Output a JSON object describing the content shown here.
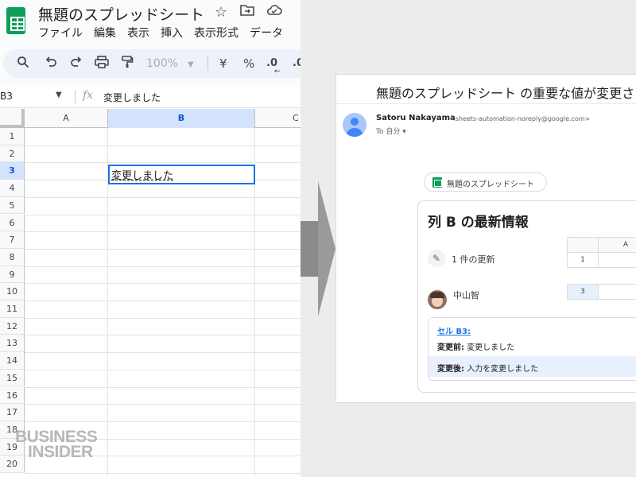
{
  "sheets": {
    "doc_title": "無題のスプレッドシート",
    "menu": [
      "ファイル",
      "編集",
      "表示",
      "挿入",
      "表示形式",
      "データ"
    ],
    "toolbar": {
      "zoom": "100%",
      "currency": "¥",
      "percent": "%",
      "decrease_decimals": ".0",
      "increase_decimals": ".0"
    },
    "name_box": "B3",
    "fx": "fx",
    "formula_value": "変更しました",
    "columns": [
      "A",
      "B",
      "C"
    ],
    "selected_column": "B",
    "rows": [
      "1",
      "2",
      "3",
      "4",
      "5",
      "6",
      "7",
      "8",
      "9",
      "10",
      "11",
      "12",
      "13",
      "14",
      "15",
      "16",
      "17",
      "18",
      "19",
      "20"
    ],
    "selected_row": "3",
    "cell_b3": "変更しました"
  },
  "watermark": [
    "BUSINESS",
    "INSIDER"
  ],
  "email": {
    "subject": "無題のスプレッドシート の重要な値が変更さ",
    "sender_name": "Satoru Nakayama",
    "sender_address": "<sheets-automation-noreply@google.com>",
    "to_label": "To 自分",
    "chip_label": "無題のスプレッドシート",
    "card_title": "列 B の最新情報",
    "update_count": "1 件の更新",
    "mini_table": {
      "col_header": "A",
      "row1": "1",
      "row3": "3"
    },
    "user_name": "中山智",
    "cell_link": "セル B3:",
    "before_label": "変更前:",
    "before_value": "変更しました",
    "after_label": "変更後:",
    "after_value": "入力を変更しました"
  },
  "colors": {
    "sheets_green": "#0f9d58",
    "selection_blue": "#1a73e8",
    "header_highlight": "#d3e3fd",
    "change_highlight": "#e8f0fe"
  }
}
